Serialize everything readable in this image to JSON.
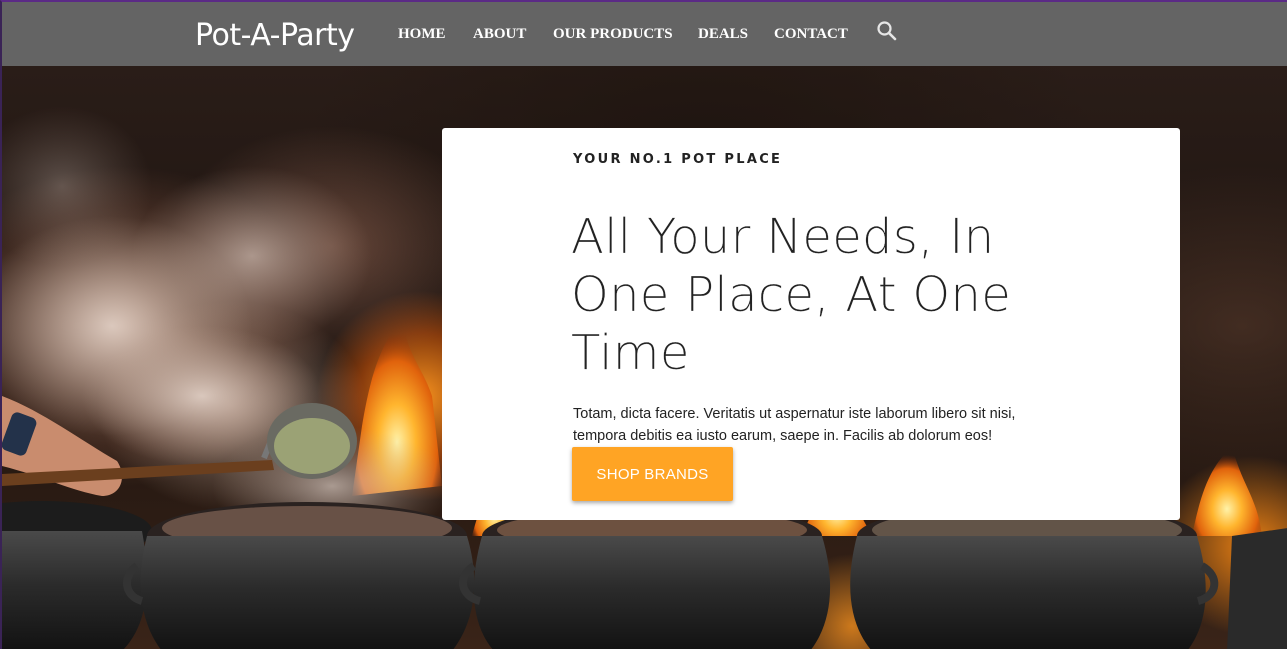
{
  "header": {
    "brand": "Pot-A-Party",
    "nav": [
      {
        "label": "HOME"
      },
      {
        "label": "ABOUT"
      },
      {
        "label": "OUR PRODUCTS"
      },
      {
        "label": "DEALS"
      },
      {
        "label": "CONTACT"
      }
    ],
    "search_icon": "search-icon",
    "background_color": "#646464"
  },
  "hero": {
    "image": "cooking pots over fire with steam",
    "eyebrow": "YOUR NO.1 POT PLACE",
    "headline": "All Your Needs, In One Place, At One Time",
    "blurb": "Totam, dicta facere. Veritatis ut aspernatur iste laborum libero sit nisi, tempora debitis ea iusto earum, saepe in. Facilis ab dolorum eos!",
    "cta_label": "SHOP BRANDS",
    "cta_color": "#ffa424"
  }
}
